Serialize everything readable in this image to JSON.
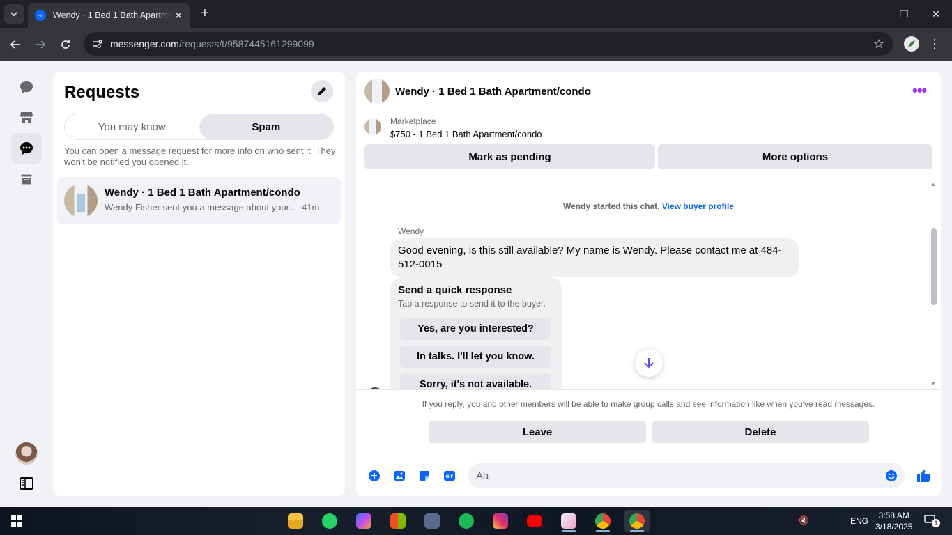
{
  "browser": {
    "tab_title": "Wendy · 1 Bed 1 Bath Apartment/condo",
    "url_host": "messenger.com",
    "url_path": "/requests/t/9587445161299099"
  },
  "rail": {
    "items": [
      "chats",
      "marketplace",
      "requests",
      "archive"
    ]
  },
  "requests": {
    "title": "Requests",
    "tabs": [
      {
        "label": "You may know",
        "active": false
      },
      {
        "label": "Spam",
        "active": true
      }
    ],
    "note": "You can open a message request for more info on who sent it. They won't be notified you opened it.",
    "items": [
      {
        "name": "Wendy · 1 Bed 1 Bath Apartment/condo",
        "preview": "Wendy Fisher sent you a message about your... ·41m"
      }
    ]
  },
  "chat": {
    "title": "Wendy · 1 Bed 1 Bath Apartment/condo",
    "marketplace": {
      "label": "Marketplace",
      "listing": "$750 - 1 Bed 1 Bath Apartment/condo",
      "mark_pending": "Mark as pending",
      "more_options": "More options"
    },
    "system_text": "Wendy started this chat.",
    "system_link": "View buyer profile",
    "sender": "Wendy",
    "message": "Good evening, is this still available? My name is Wendy. Please contact me at 484-512-0015",
    "quick": {
      "title": "Send a quick response",
      "subtitle": "Tap a response to send it to the buyer.",
      "options": [
        "Yes, are you interested?",
        "In talks. I'll let you know.",
        "Sorry, it's not available."
      ]
    },
    "notice": "If you reply, you and other members will be able to make group calls and see information like when you've read messages.",
    "leave": "Leave",
    "delete": "Delete",
    "composer_placeholder": "Aa"
  },
  "taskbar": {
    "language": "ENG",
    "time": "3:58 AM",
    "date": "3/18/2025",
    "notification_count": "1"
  },
  "colors": {
    "brand_blue": "#0866ff",
    "accent_purple": "#a033ff"
  }
}
